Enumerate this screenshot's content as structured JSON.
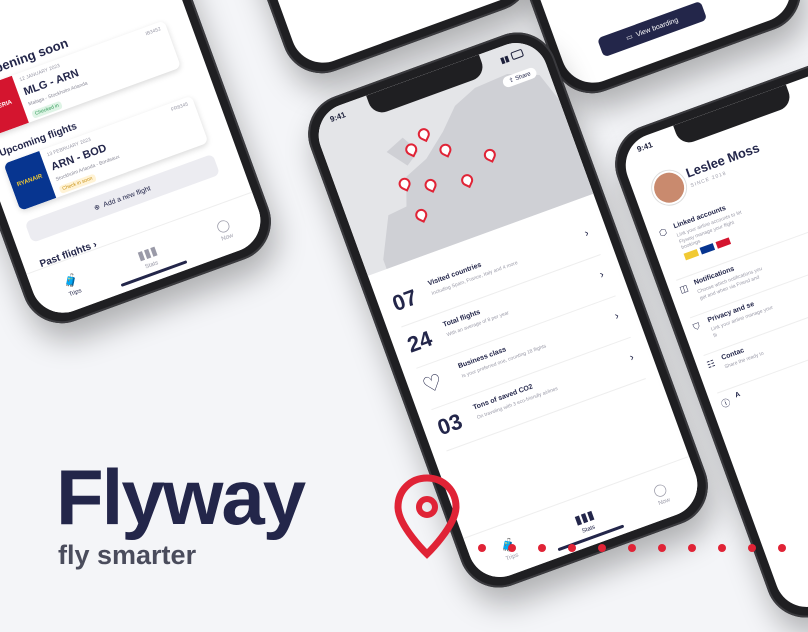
{
  "brand": {
    "name": "Flyway",
    "tagline": "fly smarter",
    "accent_color": "#e02336",
    "navy_color": "#23264a"
  },
  "trips_screen": {
    "happening_soon_heading": "Happening soon",
    "flight1": {
      "date": "12 JANUARY 2023",
      "code": "IB3452",
      "airline": "IBERIA",
      "route": "MLG - ARN",
      "sub": "Malaga - Stockholm Arlanda",
      "badge": "Checked in"
    },
    "upcoming_heading": "Upcoming flights",
    "flight2": {
      "date": "13 FEBRUARY 2023",
      "code": "FR8345",
      "airline": "RYANAIR",
      "route": "ARN - BOD",
      "sub": "Stockholm Arlanda - Bordeaux",
      "badge": "Check in soon"
    },
    "add_flight_label": "Add a new flight",
    "past_flights_label": "Past flights",
    "tabs": [
      "Trips",
      "Stats",
      "Now"
    ]
  },
  "stats_screen": {
    "time": "9:41",
    "share_label": "Share",
    "rows": [
      {
        "num": "07",
        "title": "Visited countries",
        "sub": "Including Spain, France, Italy and 4 more"
      },
      {
        "num": "24",
        "title": "Total flights",
        "sub": "With an average of 8 per year"
      },
      {
        "num": "",
        "title": "Business class",
        "sub": "Is your preferred one, counting 18 flights"
      },
      {
        "num": "03",
        "title": "Tons of saved CO2",
        "sub": "On traveling with 3 eco-friendly airlines"
      }
    ],
    "tabs": [
      "Trips",
      "Stats",
      "Now"
    ]
  },
  "profile_screen": {
    "time": "9:41",
    "name": "Leslee Moss",
    "since": "SINCE 2018",
    "rows": [
      {
        "title": "Linked accounts",
        "sub": "Link your airline accounts to let Flyway manage your flight bookings"
      },
      {
        "title": "Notifications",
        "sub": "Choose which notifications you get and when via Friend and"
      },
      {
        "title": "Privacy and se",
        "sub": "Link your airline manage your fli"
      },
      {
        "title": "Contac",
        "sub": "Share the ready to"
      },
      {
        "title": "A",
        "sub": ""
      }
    ]
  },
  "top_partial": {
    "boarding_label": "View boarding"
  }
}
